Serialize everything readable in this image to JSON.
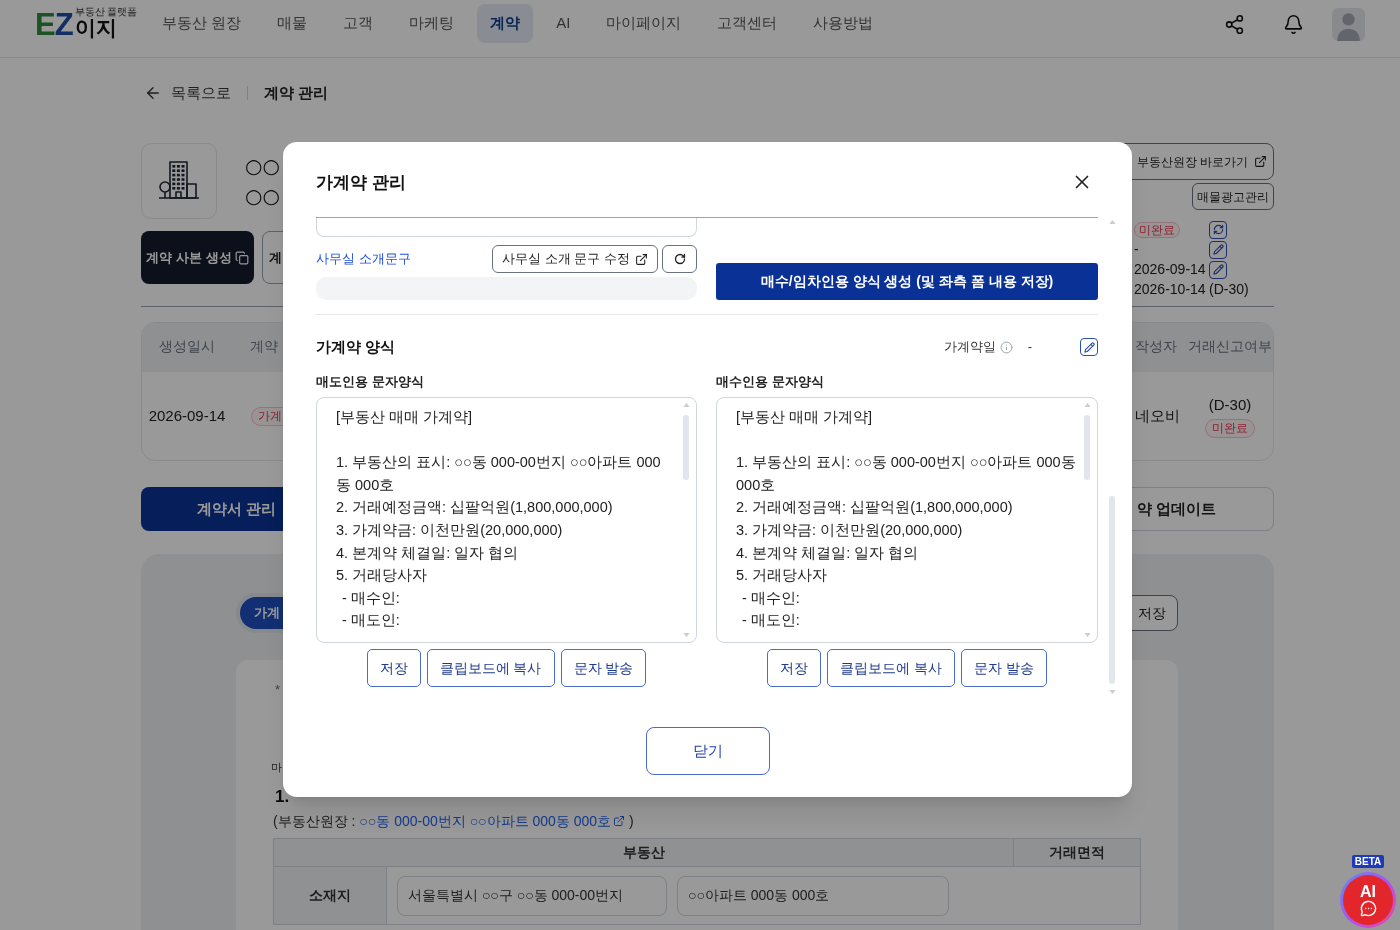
{
  "header": {
    "logo": {
      "mark": [
        "E",
        "Z"
      ],
      "name": "이지",
      "tagline": "부동산 플랫폼"
    },
    "nav": [
      {
        "label": "부동산 원장",
        "selected": false
      },
      {
        "label": "매물",
        "selected": false
      },
      {
        "label": "고객",
        "selected": false
      },
      {
        "label": "마케팅",
        "selected": false
      },
      {
        "label": "계약",
        "selected": true
      },
      {
        "label": "AI",
        "selected": false
      },
      {
        "label": "마이페이지",
        "selected": false
      },
      {
        "label": "고객센터",
        "selected": false
      },
      {
        "label": "사용방법",
        "selected": false
      }
    ]
  },
  "breadcrumb": {
    "back": "목록으로",
    "current": "계약 관리"
  },
  "property": {
    "title_lines": [
      "○○",
      "○○"
    ],
    "actions": [
      {
        "label": "계약 사본 생성",
        "kind": "primary"
      },
      {
        "label": "계",
        "kind": "outline"
      }
    ],
    "ledger_button": "부동산원장 바로가기",
    "ad_button": "매물광고관리",
    "info_rows": [
      {
        "kind": "badge",
        "text": "미완료"
      },
      {
        "kind": "text",
        "text": "-"
      },
      {
        "kind": "text",
        "text": "2026-09-14"
      },
      {
        "kind": "text",
        "text": "2026-10-14",
        "suffix": "(D-30)"
      }
    ],
    "row_actions": [
      {
        "kind": "refresh"
      },
      {
        "kind": "edit"
      },
      {
        "kind": "edit"
      }
    ]
  },
  "contract_table": {
    "columns": [
      "생성일시",
      "계약",
      "작성자",
      "거래신고여부"
    ],
    "row": {
      "created": "2026-09-14",
      "stage": "가계",
      "author": "네오비",
      "report_due": "(D-30)",
      "report_status": "미완료"
    }
  },
  "section_tabs": [
    {
      "label": "계약서 관리",
      "selected": true
    },
    {
      "label": "약 업데이트",
      "selected": false
    }
  ],
  "form_panel": {
    "tabs": [
      {
        "label": "가계",
        "selected": true
      }
    ],
    "save_button": "저장",
    "note": "*",
    "subheading": "마",
    "section_title": "1.",
    "ledger_ref": {
      "prefix": "(부동산원장 : ",
      "link": "○○동 000-00번지 ○○아파트 000동 000호",
      "suffix": " )"
    },
    "property_table": {
      "headers": [
        "부동산",
        "거래면적"
      ],
      "row_label": "소재지",
      "fields": [
        "서울특별시 ○○구 ○○동 000-00번지",
        "○○아파트 000동 000호"
      ]
    }
  },
  "modal": {
    "title": "가계약 관리",
    "office_intro": {
      "label": "사무실 소개문구",
      "edit_button": "사무실 소개 문구 수정"
    },
    "generate_button": "매수/임차인용 양식 생성 (및 좌측 폼 내용 저장)",
    "form_section": {
      "title": "가계약 양식",
      "date_label": "가계약일",
      "date_value": "-"
    },
    "templates": [
      {
        "label": "매도인용 문자양식",
        "heading": "[부동산 매매 가계약]",
        "lines": [
          {
            "text": "1. 부동산의 표시: ○○동 000-00번지 ○○아파트 000동 000호"
          },
          {
            "text": "2. 거래예정금액: 십팔억원(1,800,000,000)"
          },
          {
            "text": "3. 가계약금: 이천만원(20,000,000)"
          },
          {
            "text": "4. 본계약 체결일: 일자 협의"
          },
          {
            "text": "5. 거래당사자",
            "children": [
              {
                "text": "- 매수인:"
              },
              {
                "text": "- 매도인:"
              }
            ]
          }
        ],
        "buttons": [
          "저장",
          "클립보드에 복사",
          "문자 발송"
        ]
      },
      {
        "label": "매수인용 문자양식",
        "heading": "[부동산 매매 가계약]",
        "lines": [
          {
            "text": "1. 부동산의 표시: ○○동 000-00번지 ○○아파트 000동 000호"
          },
          {
            "text": "2. 거래예정금액: 십팔억원(1,800,000,000)"
          },
          {
            "text": "3. 가계약금: 이천만원(20,000,000)"
          },
          {
            "text": "4. 본계약 체결일: 일자 협의"
          },
          {
            "text": "5. 거래당사자",
            "children": [
              {
                "text": "- 매수인:"
              },
              {
                "text": "- 매도인:"
              }
            ]
          }
        ],
        "buttons": [
          "저장",
          "클립보드에 복사",
          "문자 발송"
        ]
      }
    ],
    "close_button": "닫기"
  },
  "ai_button": {
    "badge": "BETA",
    "label": "AI"
  }
}
